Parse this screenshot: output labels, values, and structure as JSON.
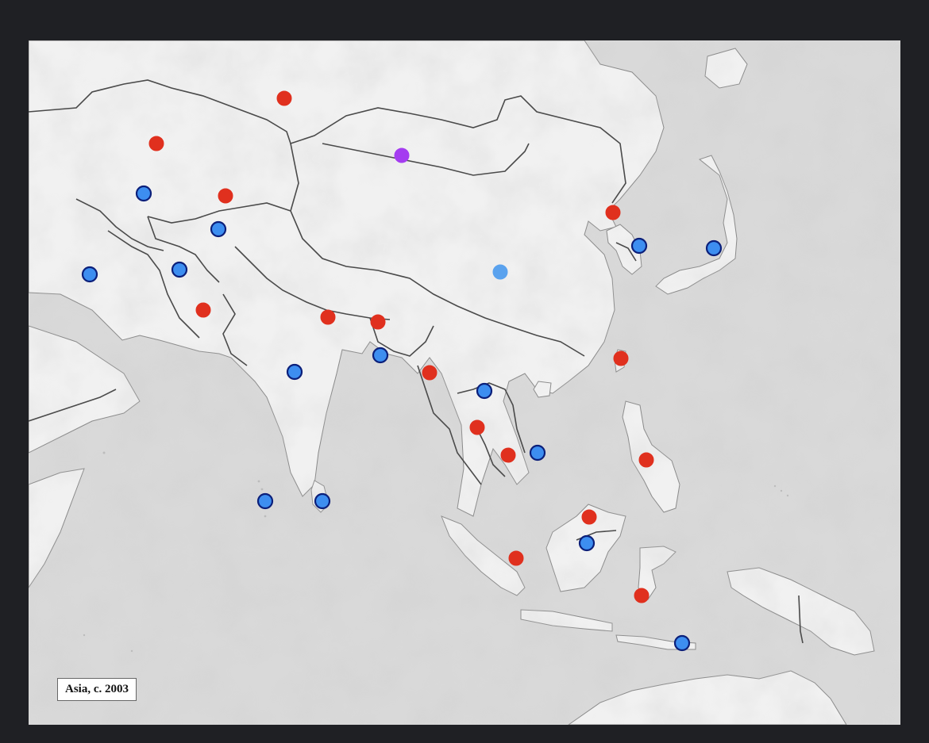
{
  "map": {
    "caption": "Asia, c. 2003",
    "colors": {
      "sea": "#d9d9d9",
      "land": "#f2f2f2",
      "relief": "#bdbdbd",
      "border": "#4a4a4a",
      "marker_red": "#e0301e",
      "marker_blue": "#3d8ef0",
      "marker_purple": "#a43cf0",
      "marker_lightblue": "#5aa2ee"
    },
    "marker_groups": [
      {
        "name": "red-markers",
        "color_key": "marker_red",
        "count": 17
      },
      {
        "name": "blue-markers",
        "color_key": "marker_blue",
        "count": 17
      },
      {
        "name": "purple-marker",
        "color_key": "marker_purple",
        "count": 1
      },
      {
        "name": "lightblue-marker",
        "color_key": "marker_lightblue",
        "count": 1
      }
    ]
  }
}
